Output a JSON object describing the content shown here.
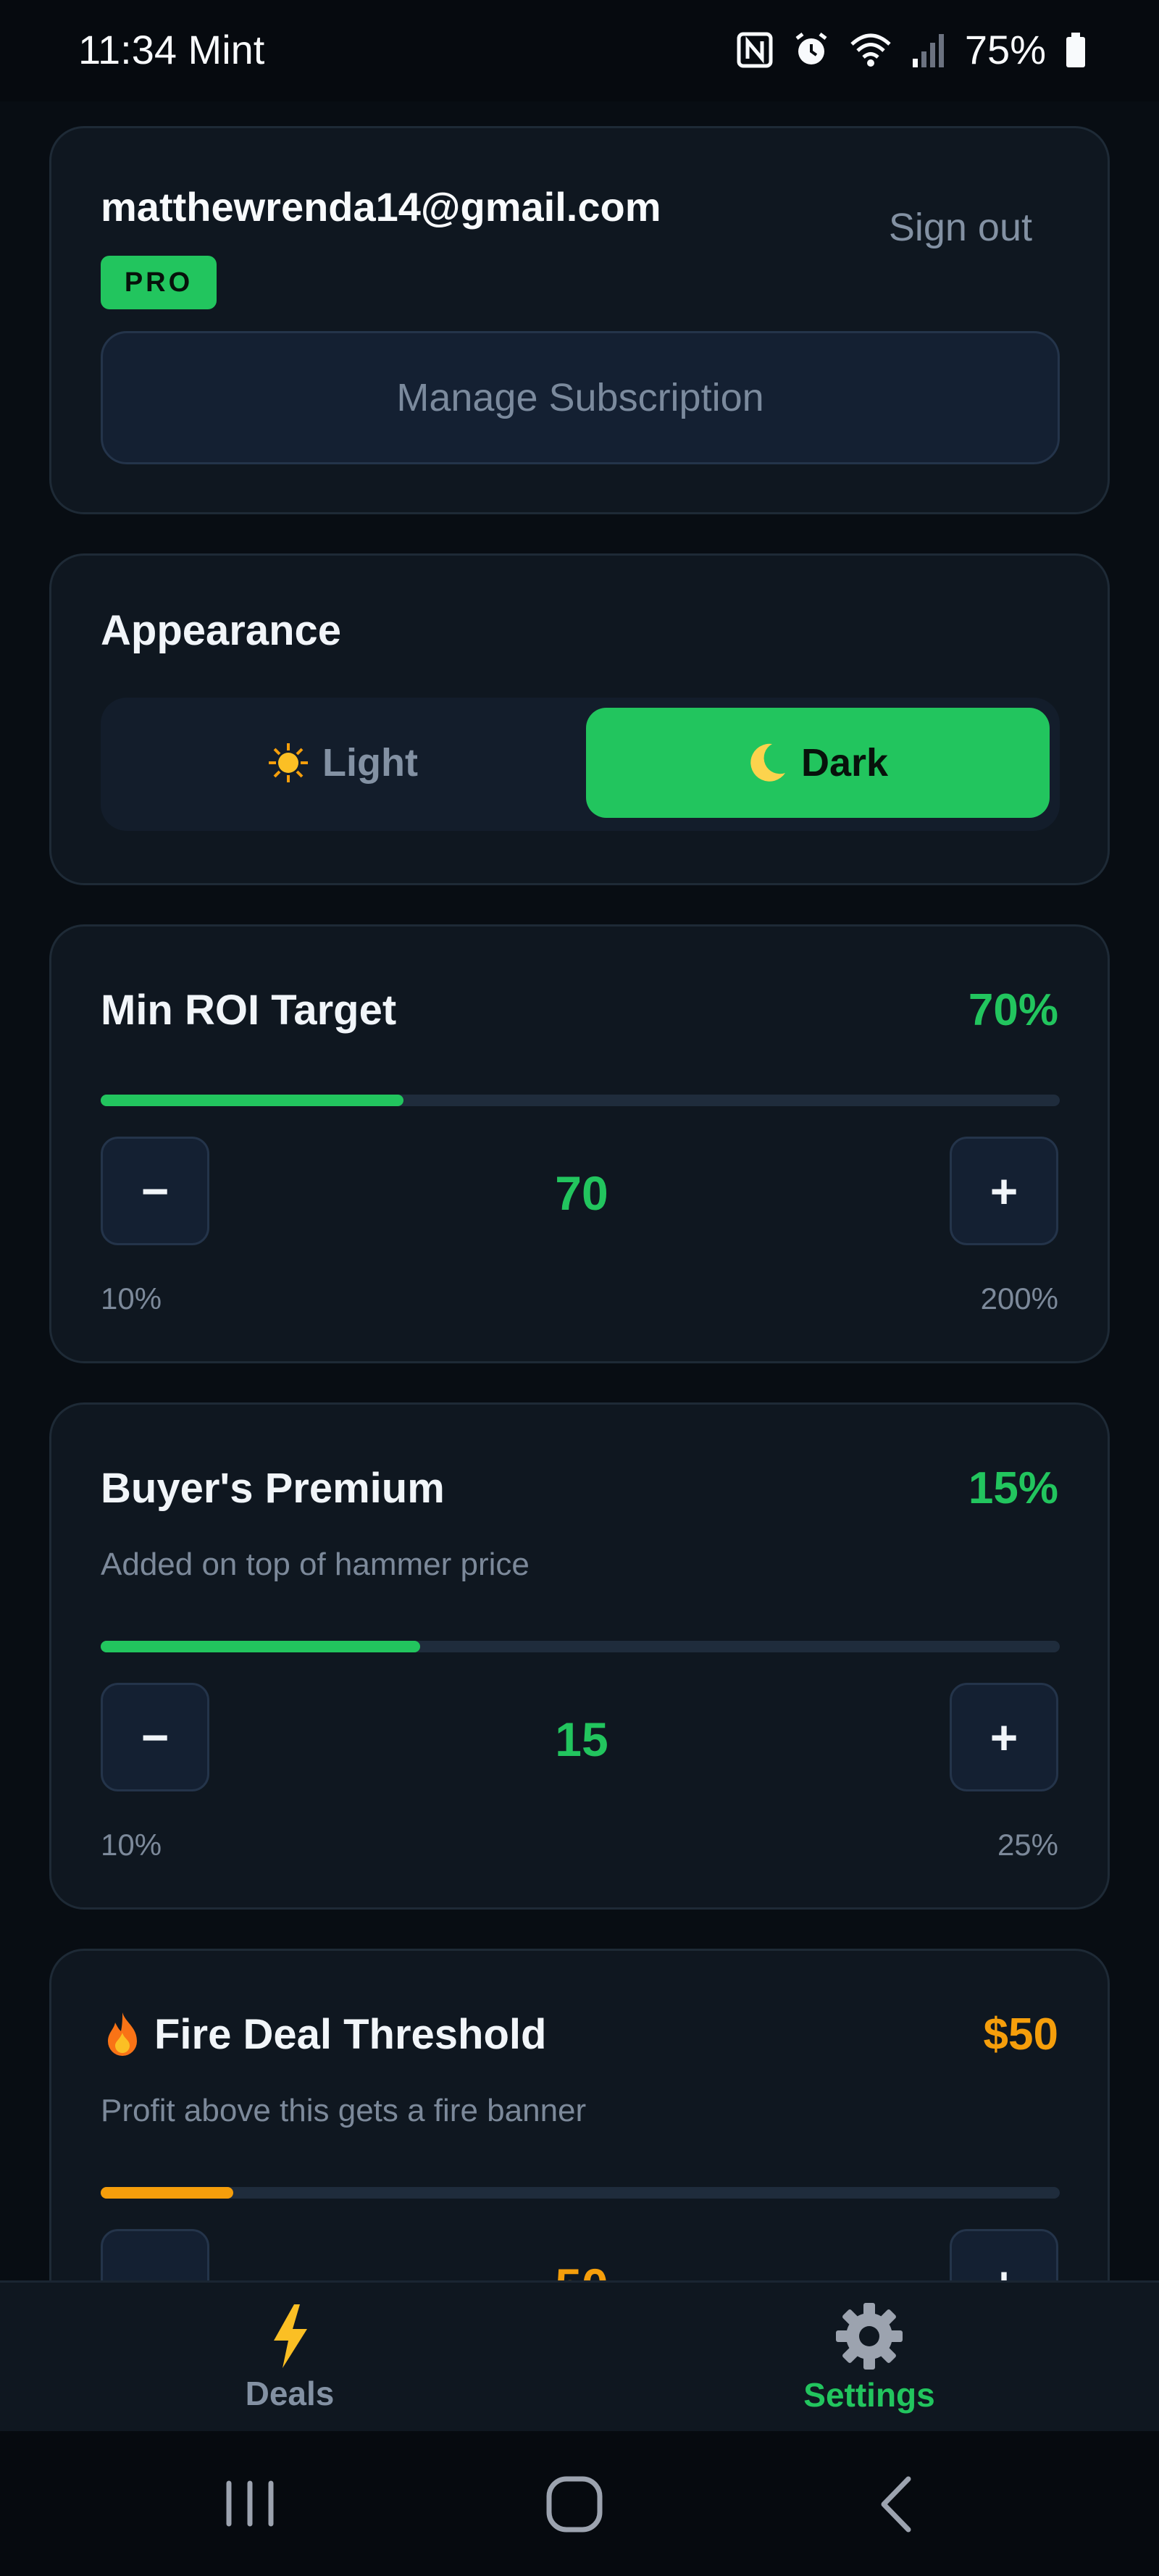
{
  "status_bar": {
    "time": "11:34 Mint",
    "battery": "75%"
  },
  "account": {
    "email": "matthewrenda14@gmail.com",
    "sign_out": "Sign out",
    "badge": "PRO",
    "manage_subscription": "Manage Subscription"
  },
  "appearance": {
    "title": "Appearance",
    "options": [
      {
        "label": "Light",
        "icon": "sun-icon",
        "selected": false
      },
      {
        "label": "Dark",
        "icon": "moon-icon",
        "selected": true
      }
    ]
  },
  "min_roi": {
    "title": "Min ROI Target",
    "value_display": "70%",
    "value": "70",
    "fill_fraction": 0.316,
    "min_label": "10%",
    "max_label": "200%",
    "minus": "−",
    "plus": "+",
    "accent": "#22c55e"
  },
  "buyers_premium": {
    "title": "Buyer's Premium",
    "subtitle": "Added on top of hammer price",
    "value_display": "15%",
    "value": "15",
    "fill_fraction": 0.333,
    "min_label": "10%",
    "max_label": "25%",
    "minus": "−",
    "plus": "+",
    "accent": "#22c55e"
  },
  "fire_deal": {
    "title": "Fire Deal Threshold",
    "subtitle": "Profit above this gets a fire banner",
    "value_display": "$50",
    "value": "50",
    "fill_fraction": 0.138,
    "minus": "−",
    "plus": "+",
    "icon": "fire-icon",
    "accent": "#f59e0b"
  },
  "bottom_nav": {
    "items": [
      {
        "label": "Deals",
        "icon": "lightning-icon",
        "active": false
      },
      {
        "label": "Settings",
        "icon": "gear-icon",
        "active": true
      }
    ]
  },
  "colors": {
    "background": "#080d13",
    "card": "#0f1720",
    "accent_green": "#22c55e",
    "accent_orange": "#f59e0b",
    "muted": "#7c899a"
  }
}
